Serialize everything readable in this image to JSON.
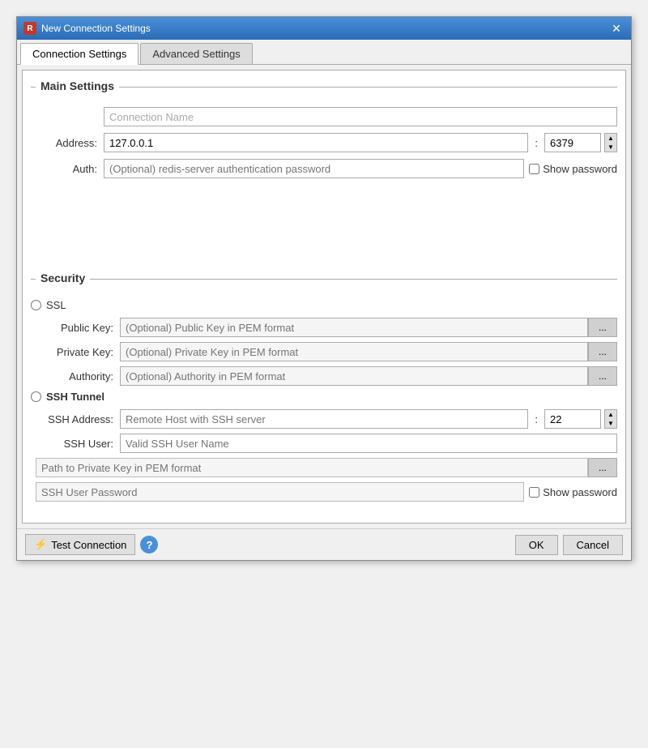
{
  "window": {
    "title": "New Connection Settings",
    "icon": "R",
    "close_label": "✕"
  },
  "tabs": [
    {
      "id": "connection",
      "label": "Connection Settings",
      "active": true
    },
    {
      "id": "advanced",
      "label": "Advanced Settings",
      "active": false
    }
  ],
  "main_section": {
    "title": "Main Settings",
    "name_placeholder": "Connection Name",
    "address_label": "Address:",
    "address_value": "127.0.0.1",
    "port_value": "6379",
    "port_up": "▲",
    "port_down": "▼",
    "colon": ":",
    "auth_label": "Auth:",
    "auth_placeholder": "(Optional) redis-server authentication password",
    "show_password_label": "Show password"
  },
  "security_section": {
    "title": "Security",
    "ssl_label": "SSL",
    "public_key_label": "Public Key:",
    "public_key_placeholder": "(Optional) Public Key in PEM format",
    "private_key_label": "Private Key:",
    "private_key_placeholder": "(Optional) Private Key in PEM format",
    "authority_label": "Authority:",
    "authority_placeholder": "(Optional) Authority in PEM format",
    "browse_label": "...",
    "ssh_tunnel_label": "SSH Tunnel",
    "ssh_address_label": "SSH Address:",
    "ssh_address_placeholder": "Remote Host with SSH server",
    "ssh_port_value": "22",
    "ssh_user_label": "SSH User:",
    "ssh_user_placeholder": "Valid SSH User Name",
    "private_key_path_placeholder": "Path to Private Key in PEM format",
    "ssh_password_placeholder": "SSH User Password",
    "show_ssh_password_label": "Show password"
  },
  "footer": {
    "test_btn_label": "Test Connection",
    "help_btn_label": "?",
    "ok_btn_label": "OK",
    "cancel_btn_label": "Cancel"
  }
}
